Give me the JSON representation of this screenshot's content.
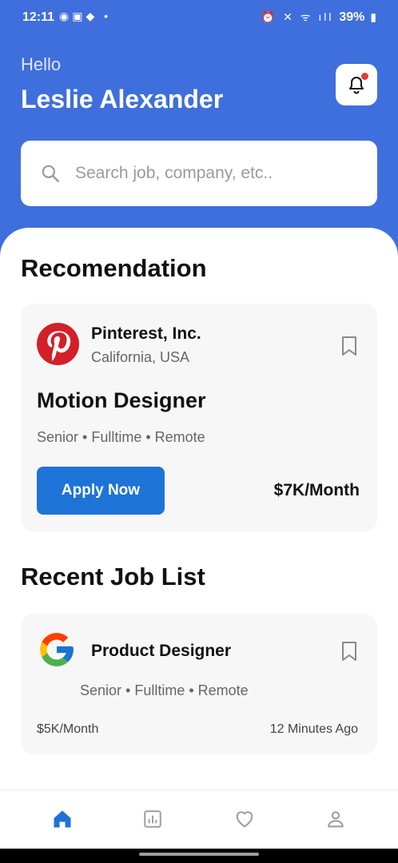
{
  "status_bar": {
    "time": "12:11",
    "battery": "39%"
  },
  "header": {
    "greeting": "Hello",
    "username": "Leslie Alexander"
  },
  "search": {
    "placeholder": "Search job, company, etc.."
  },
  "recommendation": {
    "section_title": "Recomendation",
    "company": "Pinterest, Inc.",
    "location": "California, USA",
    "job_title": "Motion Designer",
    "tags": "Senior • Fulltime • Remote",
    "apply_label": "Apply Now",
    "salary": "$7K/Month"
  },
  "recent": {
    "section_title": "Recent Job List",
    "jobs": [
      {
        "title": "Product Designer",
        "tags": "Senior • Fulltime • Remote",
        "salary": "$5K/Month",
        "posted": "12 Minutes Ago"
      }
    ]
  },
  "bottom_nav": {
    "items": [
      {
        "icon": "home-icon",
        "active": true
      },
      {
        "icon": "stats-icon",
        "active": false
      },
      {
        "icon": "heart-icon",
        "active": false
      },
      {
        "icon": "profile-icon",
        "active": false
      }
    ]
  },
  "colors": {
    "primary": "#3f6fdc",
    "button": "#1e73d6",
    "active_nav": "#1e73d6",
    "inactive_nav": "#9e9e9e",
    "notification_dot": "#e53935"
  }
}
